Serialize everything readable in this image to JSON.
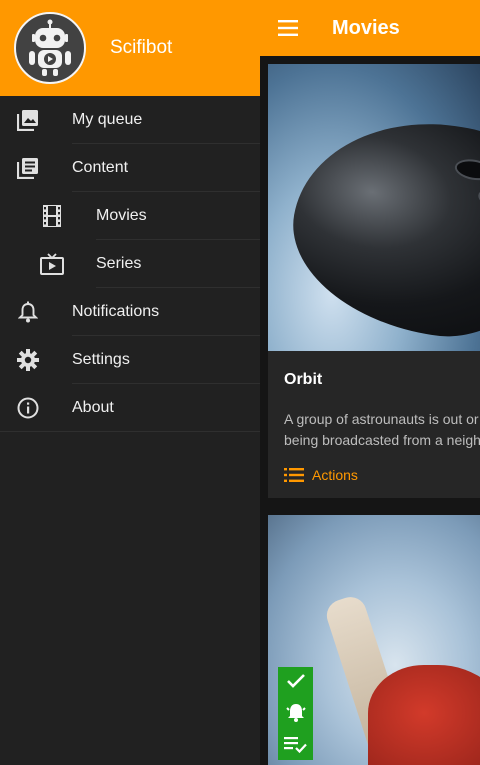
{
  "app": {
    "title": "Movies"
  },
  "drawer": {
    "brand": "Scifibot",
    "items": [
      {
        "label": "My queue",
        "icon": "photo-library-icon"
      },
      {
        "label": "Content",
        "icon": "library-books-icon"
      },
      {
        "label": "Movies",
        "icon": "film-icon"
      },
      {
        "label": "Series",
        "icon": "tv-icon"
      },
      {
        "label": "Notifications",
        "icon": "bell-icon"
      },
      {
        "label": "Settings",
        "icon": "gear-icon"
      },
      {
        "label": "About",
        "icon": "info-icon"
      }
    ]
  },
  "cards": [
    {
      "title": "Orbit",
      "description_line1": "A group of astrounauts is out or",
      "description_line2": "being broadcasted from a neigh",
      "action_label": "Actions"
    }
  ],
  "colors": {
    "accent": "#ff9800",
    "drawer_bg": "#212121",
    "fab_green": "#1fa01f"
  }
}
